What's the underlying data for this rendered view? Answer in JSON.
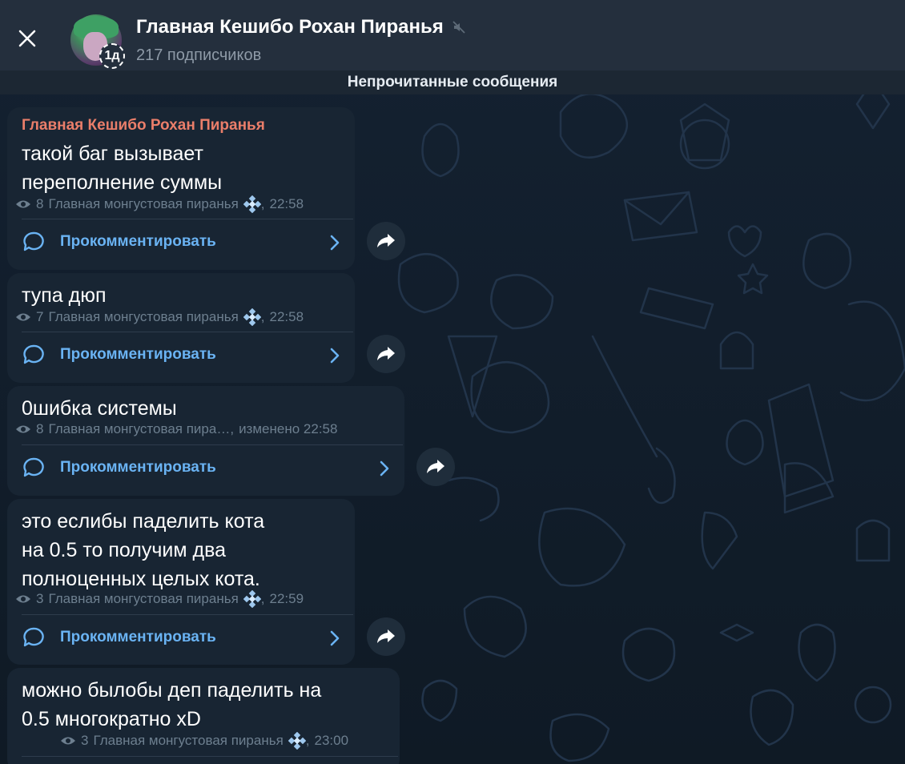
{
  "header": {
    "title": "Главная Кешибо Рохан Пиранья",
    "subtitle": "217 подписчиков",
    "timer_badge": "1д"
  },
  "unread_bar": {
    "label": "Непрочитанные сообщения"
  },
  "messages": [
    {
      "author": "Главная Кешибо Рохан Пиранья",
      "text_lines": [
        "такой баг вызывает",
        "переполнение суммы"
      ],
      "views": "8",
      "signature": "Главная монгустовая пиранья",
      "time": "22:58",
      "comment_label": "Прокомментировать"
    },
    {
      "text_lines": [
        "тупа дюп"
      ],
      "views": "7",
      "signature": "Главная монгустовая пиранья",
      "time": "22:58",
      "comment_label": "Прокомментировать"
    },
    {
      "text_lines": [
        "0шибка системы"
      ],
      "views": "8",
      "signature": "Главная монгустовая пира…",
      "time": "изменено 22:58",
      "comment_label": "Прокомментировать"
    },
    {
      "text_lines": [
        "это еслибы паделить кота",
        "на 0.5 то получим два",
        "полноценных целых кота."
      ],
      "views": "3",
      "signature": "Главная монгустовая пиранья",
      "time": "22:59",
      "comment_label": "Прокомментировать"
    },
    {
      "text_lines": [
        "можно былобы деп паделить на",
        "0.5 многократно xD"
      ],
      "views": "3",
      "signature": "Главная монгустовая пиранья",
      "time": "23:00"
    }
  ],
  "colors": {
    "header_bg": "#242f3d",
    "bubble_bg": "#182533",
    "author": "#ea7e6a",
    "link": "#6ab3f3",
    "meta": "#6d7f8f"
  },
  "icons": {
    "close": "close-icon",
    "mute": "mute-icon",
    "views": "eye-icon",
    "comment": "comment-bubble-icon",
    "chevron": "chevron-right-icon",
    "forward": "forward-icon",
    "emoji": "diamond-emoji-icon"
  }
}
